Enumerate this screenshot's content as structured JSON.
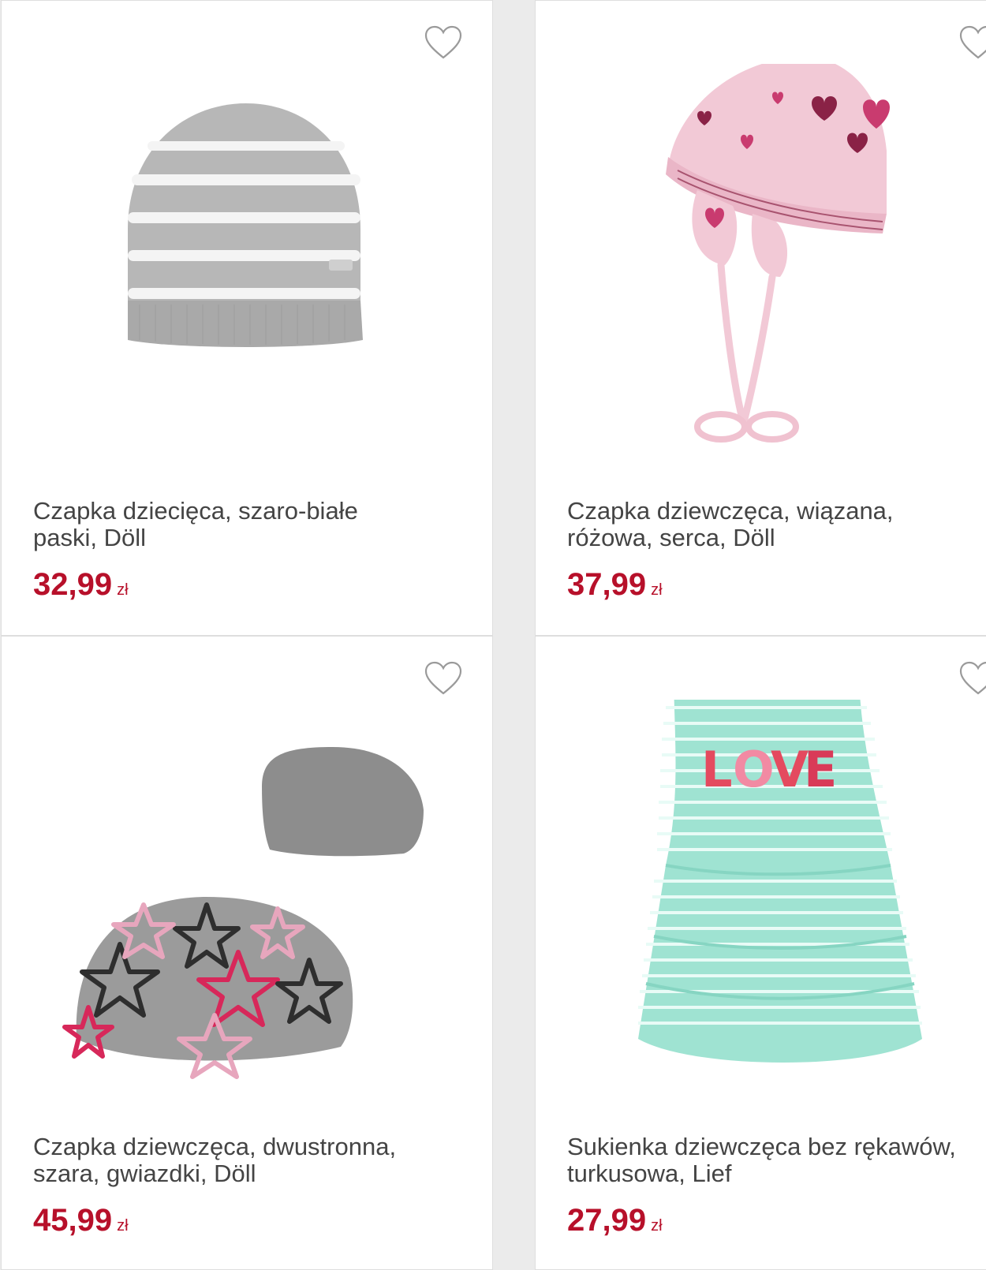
{
  "colors": {
    "price": "#b7102a",
    "title": "#444444",
    "background": "#ebebeb",
    "card": "#ffffff"
  },
  "products": [
    {
      "title_line1": "Czapka dziecięca, szaro-białe",
      "title_line2": "paski, Döll",
      "price": "32,99",
      "currency": "zł",
      "image_icon": "grey-white-striped-beanie-image"
    },
    {
      "title_line1": "Czapka dziewczęca, wiązana,",
      "title_line2": "różowa, serca, Döll",
      "price": "37,99",
      "currency": "zł",
      "image_icon": "pink-heart-tie-hat-image"
    },
    {
      "title_line1": "Czapka dziewczęca, dwustronna,",
      "title_line2": "szara, gwiazdki, Döll",
      "price": "45,99",
      "currency": "zł",
      "image_icon": "grey-star-slouch-hat-image"
    },
    {
      "title_line1": "Sukienka dziewczęca bez rękawów,",
      "title_line2": "turkusowa, Lief",
      "price": "27,99",
      "currency": "zł",
      "image_icon": "mint-striped-love-dress-image"
    }
  ]
}
